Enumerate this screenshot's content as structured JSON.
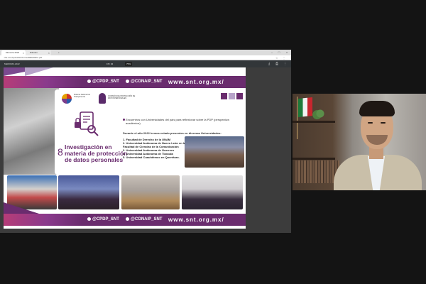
{
  "browser": {
    "tabs": [
      {
        "label": "Memoria 2022",
        "active": true
      },
      {
        "label": "Difusión",
        "active": false
      }
    ],
    "url": "...file.com/uploads/informe/MEMORIA.pdf",
    "pdf": {
      "filename": "MEMORIA 2022",
      "page": "15 / 32",
      "zoom": "75%"
    }
  },
  "slide": {
    "header": {
      "handle1": "@CPDP_SNT",
      "handle2": "@CONAIP_SNT",
      "url": "www.snt.org.mx/"
    },
    "footer": {
      "handle1": "@CPDP_SNT",
      "handle2": "@CONAIP_SNT",
      "url": "www.snt.org.mx/"
    },
    "logo1_text": "Sistema Nacional de Transparencia",
    "logo2_text": "COMISIÓN DE PROTECCIÓN DE DATOS PERSONALES",
    "section_number": "8",
    "section_title": "Investigación en materia de protección de datos personales",
    "bullet": "Encuentros con Universidades del país para reflexionar sobre la PDP (perspectiva académica).",
    "intro": "Durante el año 2022 hemos estado presentes en diversas Universidades:",
    "universities": [
      "1. Facultad de Derecho de la UNAM",
      "2. Universidad Autónoma de Nuevo León en la Facultad de Ciencias de la Comunicación",
      "3. Universidad Autónoma de Guerrero",
      "4. Universidad Autónoma de Tlaxcala",
      "5. Universidad Cuauhtémoc en Querétaro."
    ],
    "colors": {
      "purple": "#6a2c6e",
      "magenta": "#b73c77",
      "lavender": "#b7a3c9"
    }
  }
}
